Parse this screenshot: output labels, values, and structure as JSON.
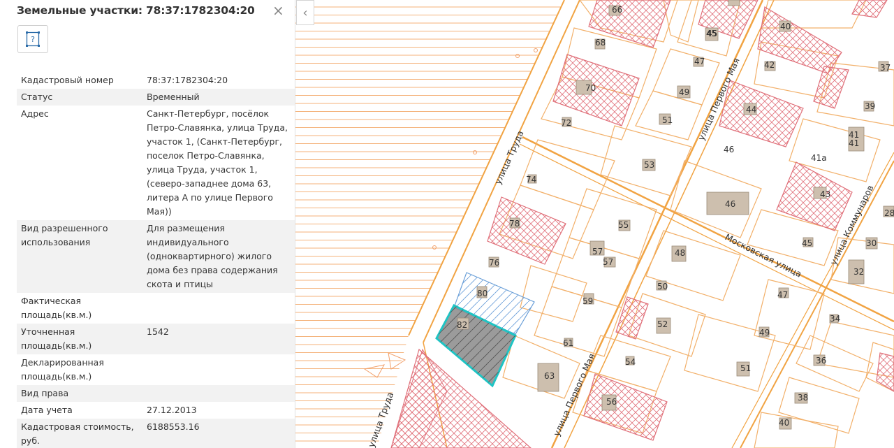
{
  "panel": {
    "title": "Земельные участки: 78:37:1782304:20",
    "close_glyph": "×",
    "action_icon": "question-mark-icon",
    "properties": [
      {
        "key": "Кадастровый номер",
        "value": "78:37:1782304:20"
      },
      {
        "key": "Статус",
        "value": "Временный"
      },
      {
        "key": "Адрес",
        "value": "Санкт-Петербург, посёлок Петро-Славянка, улица Труда, участок 1, (Санкт-Петербург, поселок Петро-Славянка, улица Труда, участок 1, (северо-западнее дома 63, литера А по улице Первого Мая))"
      },
      {
        "key": "Вид разрешенного использования",
        "value": "Для размещения индивидуального (одноквартирного) жилого дома без права содержания скота и птицы"
      },
      {
        "key": "Фактическая площадь(кв.м.)",
        "value": ""
      },
      {
        "key": "Уточненная площадь(кв.м.)",
        "value": "1542"
      },
      {
        "key": "Декларированная площадь(кв.м.)",
        "value": ""
      },
      {
        "key": "Вид права",
        "value": ""
      },
      {
        "key": "Дата учета",
        "value": "27.12.2013"
      },
      {
        "key": "Кадастровая стоимость, руб.",
        "value": "6188553.16"
      }
    ]
  },
  "map": {
    "collapse_glyph": "‹",
    "colors": {
      "hatch": "#f4b27a",
      "road": "#f1a342",
      "parcel": "#f2b06a",
      "red": "#e0707a",
      "selected": "#1fc4c4",
      "selected_fill": "#8a8a8a",
      "blue": "#6a9fd8",
      "building": "#cdbfae"
    },
    "streets": [
      {
        "id": "trudy-top",
        "name": "улица Труда"
      },
      {
        "id": "trudy-bottom",
        "name": "улица Труда"
      },
      {
        "id": "may-top",
        "name": "улица Первого Мая"
      },
      {
        "id": "may-bottom",
        "name": "улица Первого Мая"
      },
      {
        "id": "moskovskaya",
        "name": "Московская улица"
      },
      {
        "id": "kommunarov",
        "name": "улица Коммунаров"
      }
    ],
    "house_numbers": [
      "66",
      "45",
      "40",
      "68",
      "45",
      "47",
      "42",
      "37",
      "70",
      "49",
      "44",
      "39",
      "72",
      "51",
      "41",
      "41",
      "46",
      "41а",
      "53",
      "74",
      "43",
      "46",
      "78",
      "55",
      "28",
      "57",
      "57",
      "48",
      "45",
      "30",
      "76",
      "32",
      "80",
      "50",
      "47",
      "59",
      "82",
      "34",
      "52",
      "49",
      "61",
      "36",
      "51",
      "63",
      "54",
      "38",
      "56",
      "40"
    ],
    "selected_parcel": "82"
  }
}
